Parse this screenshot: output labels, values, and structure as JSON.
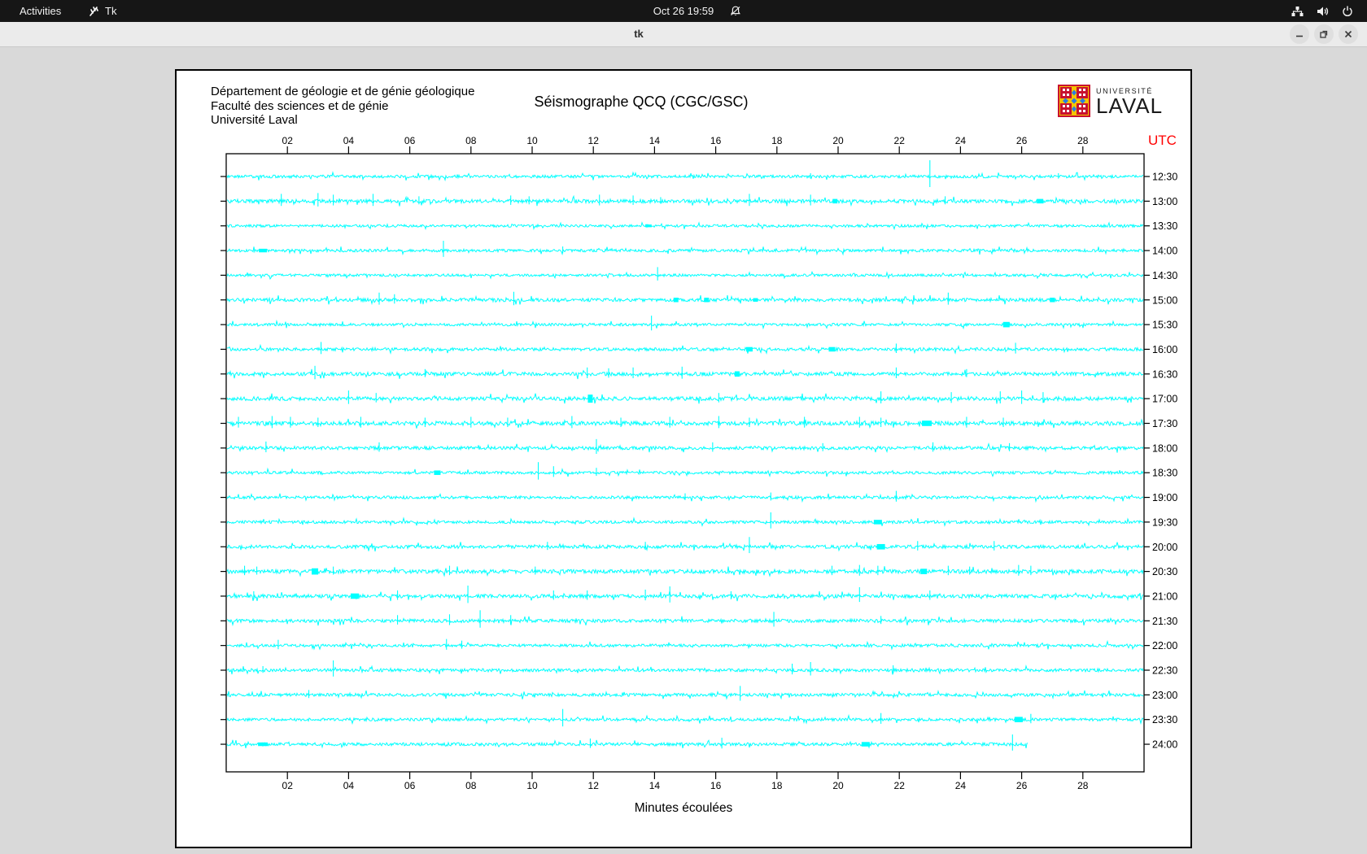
{
  "topbar": {
    "activities": "Activities",
    "app_label": "Tk",
    "clock": "Oct 26 19:59"
  },
  "titlebar": {
    "title": "tk"
  },
  "canvas": {
    "institution_lines": [
      "Département de géologie et de génie géologique",
      "Faculté des sciences et de génie",
      "Université Laval"
    ],
    "title": "Séismographe QCQ (CGC/GSC)",
    "logo": {
      "small_text": "UNIVERSITÉ",
      "big_text": "LAVAL"
    },
    "utc_label": "UTC",
    "xlabel": "Minutes écoulées"
  },
  "chart_data": {
    "type": "seismogram",
    "title": "Séismographe QCQ (CGC/GSC)",
    "xlabel": "Minutes écoulées",
    "right_axis_label": "UTC",
    "x_range_minutes": [
      0,
      30
    ],
    "x_tick_minutes": [
      2,
      4,
      6,
      8,
      10,
      12,
      14,
      16,
      18,
      20,
      22,
      24,
      26,
      28
    ],
    "x_tick_labels": [
      "02",
      "04",
      "06",
      "08",
      "10",
      "12",
      "14",
      "16",
      "18",
      "20",
      "22",
      "24",
      "26",
      "28"
    ],
    "trace_color": "#00ffff",
    "axis_color": "#000000",
    "utc_color": "#ff0000",
    "rows": [
      {
        "utc": "12:30",
        "seed": 11,
        "noise": 1.1,
        "events": [
          [
            19.1,
            4
          ],
          [
            23.0,
            20
          ],
          [
            27.2,
            4
          ]
        ]
      },
      {
        "utc": "13:00",
        "seed": 22,
        "noise": 1.4,
        "events": [
          [
            1.8,
            9
          ],
          [
            3.0,
            10
          ],
          [
            3.5,
            8
          ],
          [
            4.8,
            9
          ],
          [
            6.3,
            6
          ],
          [
            9.3,
            7
          ],
          [
            9.9,
            6
          ],
          [
            12.2,
            8
          ],
          [
            13.3,
            7
          ],
          [
            14.2,
            5
          ],
          [
            17.1,
            9
          ],
          [
            19.1,
            8
          ],
          [
            19.9,
            5,
            3
          ],
          [
            23.5,
            6
          ],
          [
            26.6,
            5,
            4
          ]
        ]
      },
      {
        "utc": "13:30",
        "seed": 33,
        "noise": 1.0,
        "events": [
          [
            13.8,
            3,
            4
          ]
        ]
      },
      {
        "utc": "14:00",
        "seed": 44,
        "noise": 1.1,
        "events": [
          [
            1.2,
            4,
            5
          ],
          [
            7.1,
            12
          ],
          [
            11.0,
            5
          ]
        ]
      },
      {
        "utc": "14:30",
        "seed": 55,
        "noise": 1.0,
        "events": [
          [
            14.1,
            10
          ]
        ]
      },
      {
        "utc": "15:00",
        "seed": 66,
        "noise": 1.3,
        "events": [
          [
            5.0,
            9
          ],
          [
            5.5,
            7
          ],
          [
            9.4,
            10
          ],
          [
            14.7,
            5,
            3
          ],
          [
            15.7,
            5,
            3
          ],
          [
            17.3,
            4,
            3
          ],
          [
            23.6,
            9
          ],
          [
            27.0,
            5,
            3
          ]
        ]
      },
      {
        "utc": "15:30",
        "seed": 77,
        "noise": 1.0,
        "events": [
          [
            13.9,
            11
          ],
          [
            25.5,
            6,
            4
          ]
        ]
      },
      {
        "utc": "16:00",
        "seed": 88,
        "noise": 1.2,
        "events": [
          [
            3.1,
            9
          ],
          [
            17.1,
            5,
            4
          ],
          [
            19.8,
            5,
            4
          ],
          [
            21.9,
            7
          ],
          [
            25.8,
            8
          ]
        ]
      },
      {
        "utc": "16:30",
        "seed": 99,
        "noise": 1.4,
        "events": [
          [
            2.9,
            10
          ],
          [
            6.5,
            6
          ],
          [
            11.8,
            8
          ],
          [
            12.5,
            7
          ],
          [
            13.3,
            8
          ],
          [
            14.9,
            9
          ],
          [
            16.7,
            6,
            3
          ],
          [
            21.9,
            8
          ],
          [
            24.2,
            6
          ]
        ]
      },
      {
        "utc": "17:00",
        "seed": 110,
        "noise": 1.5,
        "events": [
          [
            4.0,
            10
          ],
          [
            4.9,
            7
          ],
          [
            11.9,
            9,
            3
          ],
          [
            16.1,
            7
          ],
          [
            21.4,
            9
          ],
          [
            23.7,
            8
          ],
          [
            25.3,
            9
          ],
          [
            26.0,
            10
          ],
          [
            26.7,
            8
          ]
        ]
      },
      {
        "utc": "17:30",
        "seed": 121,
        "noise": 1.6,
        "events": [
          [
            0.4,
            8
          ],
          [
            1.5,
            9
          ],
          [
            2.1,
            8
          ],
          [
            3.0,
            7
          ],
          [
            4.4,
            8
          ],
          [
            6.5,
            7
          ],
          [
            8.0,
            8
          ],
          [
            9.2,
            7
          ],
          [
            11.3,
            9
          ],
          [
            12.9,
            7
          ],
          [
            14.5,
            8
          ],
          [
            16.1,
            9
          ],
          [
            17.1,
            7
          ],
          [
            18.9,
            8
          ],
          [
            20.7,
            8
          ],
          [
            21.4,
            7
          ],
          [
            22.9,
            6,
            6
          ],
          [
            24.2,
            8
          ],
          [
            25.4,
            7
          ]
        ]
      },
      {
        "utc": "18:00",
        "seed": 132,
        "noise": 1.3,
        "events": [
          [
            1.3,
            8
          ],
          [
            5.0,
            7
          ],
          [
            12.1,
            11
          ],
          [
            15.9,
            7
          ],
          [
            19.5,
            6
          ],
          [
            23.1,
            7
          ],
          [
            25.6,
            6
          ]
        ]
      },
      {
        "utc": "18:30",
        "seed": 143,
        "noise": 1.1,
        "events": [
          [
            6.9,
            5,
            4
          ],
          [
            10.2,
            13
          ],
          [
            10.7,
            8
          ],
          [
            12.1,
            6
          ]
        ]
      },
      {
        "utc": "19:00",
        "seed": 154,
        "noise": 1.1,
        "events": [
          [
            15.0,
            5
          ],
          [
            17.8,
            6
          ],
          [
            21.9,
            8
          ]
        ]
      },
      {
        "utc": "19:30",
        "seed": 165,
        "noise": 1.1,
        "events": [
          [
            17.8,
            12
          ],
          [
            21.3,
            5,
            5
          ]
        ]
      },
      {
        "utc": "20:00",
        "seed": 176,
        "noise": 1.3,
        "events": [
          [
            10.5,
            6
          ],
          [
            13.7,
            6
          ],
          [
            17.1,
            12
          ],
          [
            21.4,
            6,
            5
          ],
          [
            22.6,
            7
          ],
          [
            25.1,
            7
          ]
        ]
      },
      {
        "utc": "20:30",
        "seed": 187,
        "noise": 1.5,
        "events": [
          [
            0.6,
            7
          ],
          [
            1.0,
            6
          ],
          [
            2.9,
            7,
            4
          ],
          [
            3.5,
            6
          ],
          [
            7.3,
            7
          ],
          [
            10.1,
            6
          ],
          [
            19.8,
            7
          ],
          [
            20.7,
            8
          ],
          [
            21.3,
            7
          ],
          [
            22.8,
            6,
            4
          ],
          [
            23.6,
            7
          ],
          [
            24.3,
            6
          ],
          [
            25.9,
            8
          ],
          [
            26.3,
            7
          ]
        ]
      },
      {
        "utc": "21:00",
        "seed": 198,
        "noise": 1.4,
        "events": [
          [
            0.9,
            6
          ],
          [
            4.2,
            6,
            5
          ],
          [
            5.6,
            7
          ],
          [
            7.9,
            13
          ],
          [
            10.7,
            7
          ],
          [
            11.8,
            7
          ],
          [
            13.7,
            8
          ],
          [
            14.5,
            12
          ],
          [
            16.5,
            6
          ],
          [
            20.7,
            11
          ],
          [
            23.0,
            7
          ]
        ]
      },
      {
        "utc": "21:30",
        "seed": 209,
        "noise": 1.3,
        "events": [
          [
            5.6,
            7
          ],
          [
            7.3,
            8
          ],
          [
            8.3,
            13
          ],
          [
            9.3,
            7
          ],
          [
            17.9,
            11
          ],
          [
            21.4,
            6
          ]
        ]
      },
      {
        "utc": "22:00",
        "seed": 220,
        "noise": 1.1,
        "events": [
          [
            1.7,
            7
          ],
          [
            7.2,
            8
          ],
          [
            7.7,
            6
          ]
        ]
      },
      {
        "utc": "22:30",
        "seed": 231,
        "noise": 1.2,
        "events": [
          [
            1.2,
            5
          ],
          [
            3.5,
            12
          ],
          [
            18.5,
            8
          ],
          [
            19.1,
            10
          ],
          [
            21.8,
            6
          ]
        ]
      },
      {
        "utc": "23:00",
        "seed": 242,
        "noise": 1.2,
        "events": [
          [
            2.7,
            6
          ],
          [
            16.8,
            11
          ]
        ]
      },
      {
        "utc": "23:30",
        "seed": 253,
        "noise": 1.1,
        "events": [
          [
            11.0,
            13
          ],
          [
            21.4,
            8
          ],
          [
            25.9,
            6,
            5
          ],
          [
            26.3,
            7
          ]
        ]
      },
      {
        "utc": "24:00",
        "seed": 264,
        "noise": 1.2,
        "end_m": 26.2,
        "events": [
          [
            1.2,
            4,
            6
          ],
          [
            11.9,
            7
          ],
          [
            16.2,
            8
          ],
          [
            20.9,
            5,
            5
          ],
          [
            25.7,
            12
          ]
        ]
      }
    ]
  }
}
